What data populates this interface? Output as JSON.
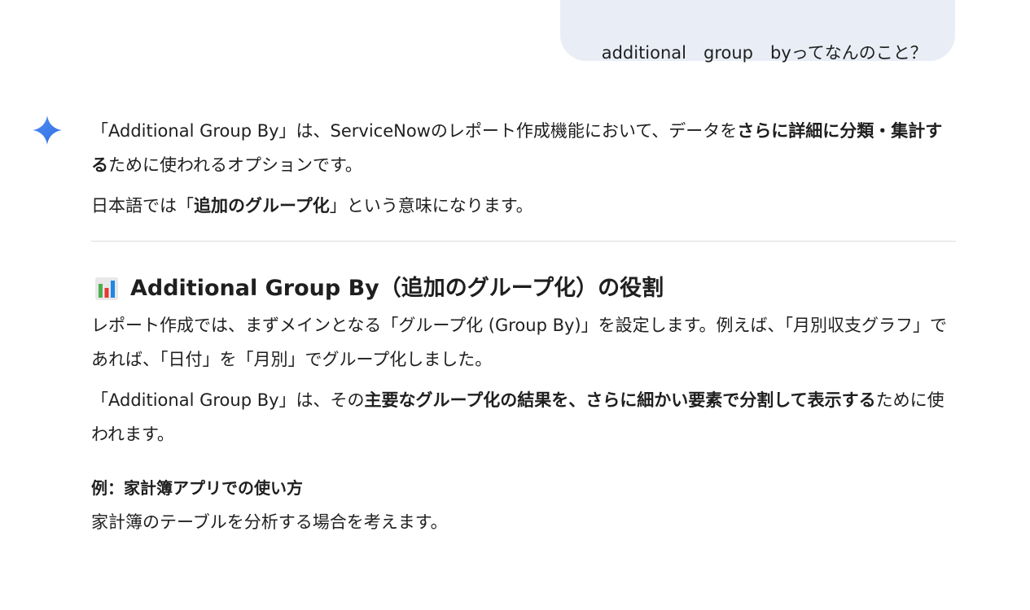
{
  "user_message": "additional　group　byってなんのこと？",
  "response": {
    "p1": {
      "t1": "「Additional Group By」は、ServiceNowのレポート作成機能において、データを",
      "b1": "さらに詳細に分類・集計する",
      "t2": "ために使われるオプションです。"
    },
    "p2": {
      "t1": "日本語では「",
      "b1": "追加のグループ化",
      "t2": "」という意味になります。"
    },
    "section": {
      "icon": "bar-chart-icon",
      "title": "Additional Group By（追加のグループ化）の役割",
      "p1": "レポート作成では、まずメインとなる「グループ化 (Group By)」を設定します。例えば、「月別収支グラフ」であれば、「日付」を「月別」でグループ化しました。",
      "p2": {
        "t1": "「Additional Group By」は、その",
        "b1": "主要なグループ化の結果を、さらに細かい要素で分割して表示する",
        "t2": "ために使われます。"
      },
      "example_title": "例：家計簿アプリでの使い方",
      "example_text": "家計簿のテーブルを分析する場合を考えます。"
    }
  },
  "colors": {
    "user_bubble": "#e9eef6",
    "sparkle": "#4285f4",
    "text": "#1f1f1f",
    "divider": "#dadce0"
  }
}
